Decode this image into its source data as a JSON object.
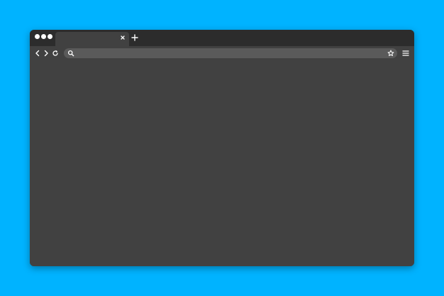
{
  "browser": {
    "tab": {
      "title": ""
    },
    "address_bar": {
      "value": "",
      "placeholder": ""
    },
    "icons": {
      "window_controls": "three-dots-icon",
      "tab_close": "close-icon",
      "new_tab": "plus-icon",
      "back": "chevron-left-icon",
      "forward": "chevron-right-icon",
      "reload": "reload-icon",
      "search": "search-icon",
      "bookmark": "star-icon",
      "menu": "hamburger-menu-icon"
    }
  },
  "colors": {
    "backdrop": "#00b3ff",
    "window_body": "#414141",
    "tab_strip": "#2c2c2c",
    "address_bar": "#5a5a5a",
    "icon": "#ffffff"
  }
}
